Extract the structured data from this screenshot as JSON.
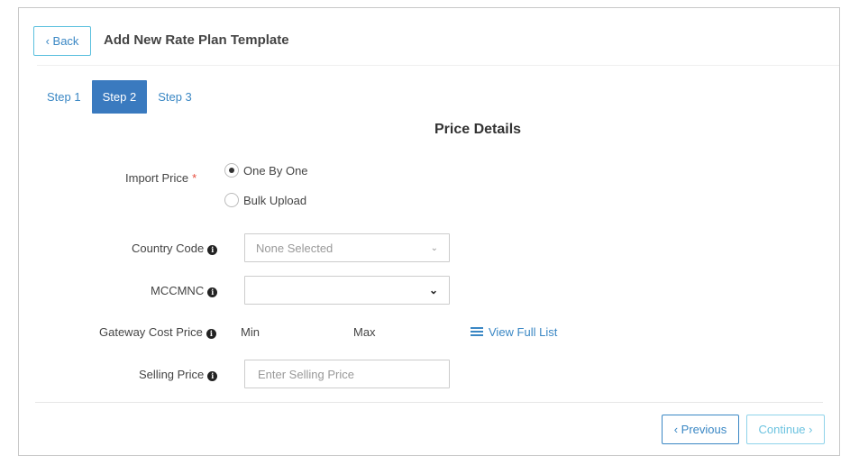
{
  "header": {
    "back_label": "‹ Back",
    "title": "Add New Rate Plan Template"
  },
  "tabs": [
    {
      "label": "Step 1",
      "active": false
    },
    {
      "label": "Step 2",
      "active": true
    },
    {
      "label": "Step 3",
      "active": false
    }
  ],
  "section_title": "Price Details",
  "form": {
    "import_price": {
      "label": "Import Price",
      "required_mark": "*",
      "options": [
        {
          "label": "One By One",
          "checked": true
        },
        {
          "label": "Bulk Upload",
          "checked": false
        }
      ]
    },
    "country_code": {
      "label": "Country Code",
      "value": "None Selected",
      "caret": "⌄"
    },
    "mccmnc": {
      "label": "MCCMNC",
      "value": "",
      "caret": "⌄"
    },
    "gateway_cost_price": {
      "label": "Gateway Cost Price",
      "min_label": "Min",
      "max_label": "Max",
      "view_full_list": "View Full List"
    },
    "selling_price": {
      "label": "Selling Price",
      "placeholder": "Enter Selling Price",
      "value": ""
    }
  },
  "icons": {
    "info": "i",
    "list": "list-icon"
  },
  "footer": {
    "previous_label": "‹ Previous",
    "continue_label": "Continue ›"
  },
  "colors": {
    "accent": "#3a87c4",
    "active_tab": "#3a7abf",
    "required": "#e74c3c"
  }
}
